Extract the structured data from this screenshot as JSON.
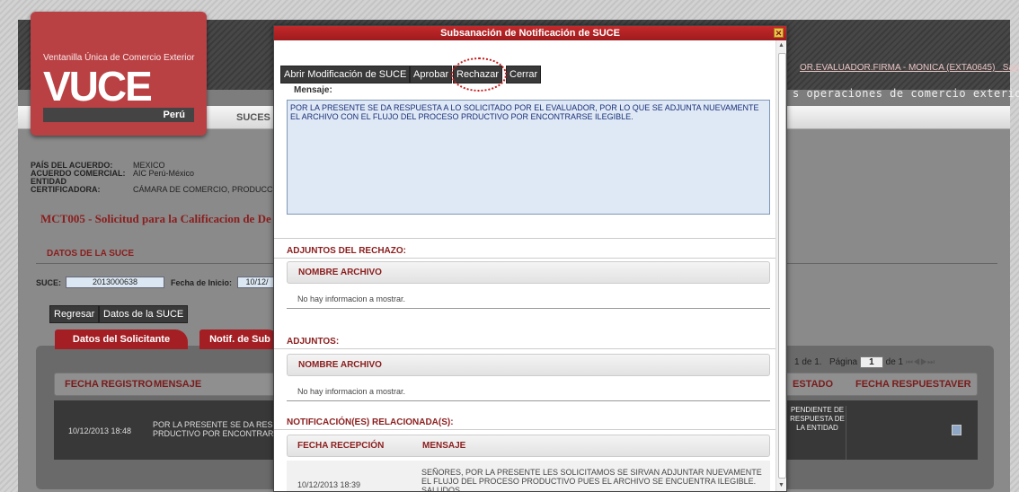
{
  "header": {
    "logo_subtitle": "Ventanilla Única de Comercio Exterior",
    "logo_text": "VUCE",
    "logo_country": "Perú",
    "user_link": "OR.EVALUADOR.FIRMA - MONICA (EXTA0645)",
    "exit_link": "Salir »",
    "slogan": "s operaciones de comercio exterior",
    "menu_label": "SUCES"
  },
  "info": {
    "pais_label": "PAÍS DEL ACUERDO:",
    "pais_value": "MEXICO",
    "acuerdo_label": "ACUERDO COMERCIAL:",
    "acuerdo_value": "AIC Perú-México",
    "entidad_label": "ENTIDAD CERTIFICADORA:",
    "entidad_value": "CÁMARA DE COMERCIO, PRODUCCIÓ"
  },
  "page_title": "MCT005 - Solicitud para la Calificacion de De",
  "datos_suce": {
    "heading": "DATOS DE LA SUCE",
    "suce_label": "SUCE:",
    "suce_value": "2013000638",
    "fecha_label": "Fecha de Inicio:",
    "fecha_value": "10/12/"
  },
  "buttons": {
    "regresar": "Regresar",
    "datos_suce": "Datos de la SUCE"
  },
  "tabs": {
    "tab1": "Datos del Solicitante",
    "tab2": "Notif. de Sub"
  },
  "pagination": {
    "text": "1 de 1.",
    "page_label": "Página",
    "page_value": "1",
    "total": "de 1"
  },
  "table": {
    "headers": {
      "fecha": "FECHA REGISTRO",
      "mensaje": "MENSAJE",
      "estado": "ESTADO",
      "fecha_resp": "FECHA RESPUESTA",
      "ver": "VER"
    },
    "row": {
      "fecha": "10/12/2013 18:48",
      "mensaje1": "POR LA PRESENTE SE DA RESPUE",
      "mensaje2": "PRDUCTIVO POR ENCONTRARSE I",
      "estado": "PENDIENTE DE RESPUESTA DE LA ENTIDAD"
    }
  },
  "modal": {
    "title": "Subsanación de Notificación de SUCE",
    "close": "✕",
    "buttons": {
      "abrir": "Abrir Modificación de SUCE",
      "aprobar": "Aprobar",
      "rechazar": "Rechazar",
      "cerrar": "Cerrar"
    },
    "mensaje_label": "Mensaje:",
    "mensaje_text": "POR LA PRESENTE SE DA RESPUESTA A LO SOLICITADO POR EL EVALUADOR, POR LO QUE SE ADJUNTA NUEVAMENTE EL ARCHIVO CON EL FLUJO DEL PROCESO PRDUCTIVO POR ENCONTRARSE ILEGIBLE.",
    "adjuntos_rechazo": {
      "title": "ADJUNTOS DEL RECHAZO:",
      "header": "NOMBRE ARCHIVO",
      "empty": "No hay informacion a mostrar."
    },
    "adjuntos": {
      "title": "ADJUNTOS:",
      "header": "NOMBRE ARCHIVO",
      "empty": "No hay informacion a mostrar."
    },
    "notificaciones": {
      "title": "NOTIFICACIÓN(ES) RELACIONADA(S):",
      "header_fecha": "FECHA RECEPCIÓN",
      "header_mensaje": "MENSAJE",
      "row_fecha": "10/12/2013 18:39",
      "row_mensaje": "SEÑORES, POR LA PRESENTE LES SOLICITAMOS SE SIRVAN ADJUNTAR NUEVAMENTE EL FLUJO DEL PROCESO PRODUCTIVO PUES EL ARCHIVO SE ENCUENTRA ILEGIBLE. SALUDOS,"
    }
  },
  "colors": {
    "brand_red": "#b94144",
    "title_red": "#8b1d1d",
    "modal_header": "#a41f24"
  },
  "icons": {
    "close": "close-icon",
    "view": "document-icon"
  }
}
